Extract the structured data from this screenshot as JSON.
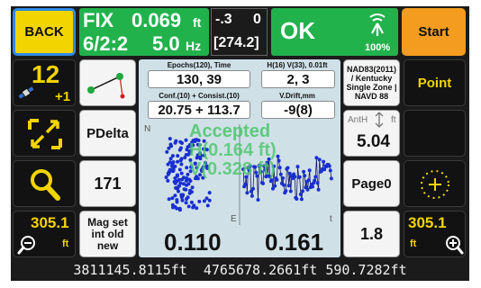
{
  "top": {
    "back_label": "BACK",
    "fix_label": "FIX",
    "hrms": "0.069",
    "hrms_unit": "ft",
    "sats_line": "6/2:2",
    "rate": "5.0",
    "rate_unit": "Hz",
    "latency": "-.3",
    "age": "0",
    "bracket_value": "[274.2]",
    "link_status": "OK",
    "radio_percent": "100%",
    "start_label": "Start"
  },
  "left": {
    "sat_count": "12",
    "sat_delta": "+1",
    "zoom_out_value": "305.1",
    "zoom_out_unit": "ft"
  },
  "middle": {
    "pdelta_label": "PDelta",
    "point_count": "171",
    "mag_set_label": "Mag set int old new",
    "epochs_caption": "Epochs(120), Time",
    "epochs_value": "130, 39",
    "hv_caption": "H(16) V(33), 0.01ft",
    "hv_value": "2, 3",
    "conf_caption": "Conf.(10) + Consist.(10)",
    "conf_value": "20.75 + 113.7",
    "vdrift_caption": "V.Drift,mm",
    "vdrift_value": "-9(8)",
    "plot_label_n": "N",
    "plot_label_e": "E",
    "plot_label_t": "t",
    "overlay_status": "Accepted",
    "overlay_h": "H(0.164 ft)",
    "overlay_v": "V(0.328 ft)",
    "h_value": "0.110",
    "v_value": "0.161"
  },
  "right": {
    "datum_text": "NAD83(2011) / Kentucky Single Zone | NAVD 88",
    "anth_label": "AntH",
    "anth_unit": "ft",
    "anth_value": "5.04",
    "page_label": "Page0",
    "value_18": "1.8",
    "point_label": "Point",
    "zoom_in_value": "305.1",
    "zoom_in_unit": "ft"
  },
  "status_bar": {
    "coords": "3811145.8115ft  4765678.2661ft 590.7282ft"
  },
  "colors": {
    "accent_yellow": "#f2d400",
    "start_orange": "#f39c1f",
    "ok_green": "#22b24c",
    "back_blue": "#2e8ae6",
    "plot_dot": "#1a2fd0",
    "overlay_green": "#4ac76a"
  }
}
